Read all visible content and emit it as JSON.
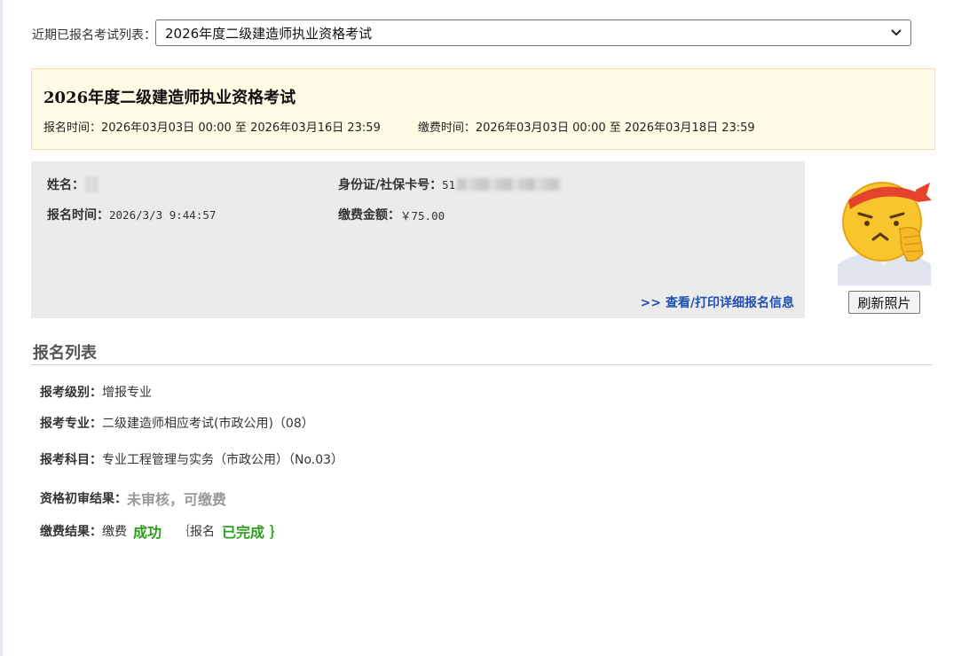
{
  "selector": {
    "label": "近期已报名考试列表：",
    "selected": "2026年度二级建造师执业资格考试"
  },
  "exam": {
    "title": "2026年度二级建造师执业资格考试",
    "register_label": "报名时间：",
    "register_start": "2026年03月03日 00:00",
    "to_1": "至",
    "register_end": "2026年03月16日 23:59",
    "payment_label": "缴费时间：",
    "payment_start": "2026年03月03日 00:00",
    "to_2": "至",
    "payment_end": "2026年03月18日 23:59"
  },
  "person": {
    "name_label": "姓名：",
    "id_label": "身份证/社保卡号：",
    "id_prefix": "51",
    "reg_time_label": "报名时间：",
    "reg_time": "2026/3/3 9:44:57",
    "fee_label": "缴费金额：",
    "fee": "￥75.00",
    "print_link": ">> 查看/打印详细报名信息",
    "refresh_photo": "刷新照片"
  },
  "registration": {
    "section_title": "报名列表",
    "level_label": "报考级别：",
    "level": "增报专业",
    "major_label": "报考专业：",
    "major": "二级建造师相应考试(市政公用)（08）",
    "subject_label": "报考科目：",
    "subject": "专业工程管理与实务（市政公用）（No.03）",
    "review_label": "资格初审结果：",
    "review": "未审核，可缴费",
    "pay_label": "缴费结果：",
    "pay_text": "缴费",
    "pay_status": "成功",
    "brace_open": "｛",
    "reg_text": "报名",
    "reg_status": "已完成",
    "brace_close": "｝"
  },
  "colors": {
    "link": "#1f4fb4",
    "success": "#2e9e1f",
    "muted": "#999999",
    "exam_box_bg": "#fffbe6",
    "panel_bg": "#ebebeb"
  }
}
